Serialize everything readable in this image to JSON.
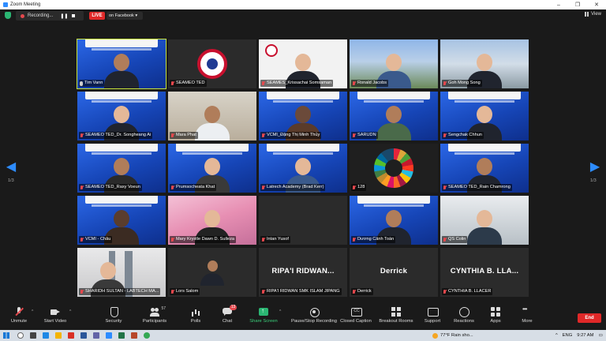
{
  "window": {
    "title": "Zoom Meeting",
    "controls": [
      "–",
      "❐",
      "✕"
    ]
  },
  "topbar": {
    "recording_label": "Recording...",
    "live_label": "LIVE",
    "live_on": "on Facebook ▾",
    "view_label": "View"
  },
  "pagination": {
    "left": "1/3",
    "right": "1/3"
  },
  "tiles": [
    {
      "name": "Tim Vann",
      "muted": false
    },
    {
      "name": "SEAMEO TED",
      "muted": true
    },
    {
      "name": "SEAMES_Krissachai Somsaman",
      "muted": true
    },
    {
      "name": "Ronald Jacobs",
      "muted": true
    },
    {
      "name": "Goh Mong Song",
      "muted": true
    },
    {
      "name": "SEAMEO TED_Dr. Songheang Ai",
      "muted": true
    },
    {
      "name": "Mara Phat",
      "muted": true
    },
    {
      "name": "VCMI_Đặng Thị Minh Thủy",
      "muted": true
    },
    {
      "name": "SARUDN",
      "muted": true
    },
    {
      "name": "Sengchak Chhun",
      "muted": true
    },
    {
      "name": "SEAMEO TED_Raxy Voeun",
      "muted": true
    },
    {
      "name": "Prumsocheata Khat",
      "muted": true
    },
    {
      "name": "Latrech Academy (Brad Kerr)",
      "muted": true
    },
    {
      "name": "128",
      "muted": true
    },
    {
      "name": "SEAMEO TED_Rain Chamrong",
      "muted": true
    },
    {
      "name": "VCMI - Châu",
      "muted": true
    },
    {
      "name": "Mary Krystle Dawn D. Sulleza",
      "muted": true
    },
    {
      "name": "Intan Yusof",
      "muted": true
    },
    {
      "name": "Dương Cảnh Toàn",
      "muted": true
    },
    {
      "name": "QS Colin",
      "muted": true
    },
    {
      "name": "SHARIDH SULTAN - LABTECH MA...",
      "muted": true
    },
    {
      "name": "Lors Salom",
      "muted": true
    },
    {
      "name": "RIPA'I RIDWAN SMK ISLAM JIPANG",
      "muted": true,
      "display": "RIPA'I RIDWAN..."
    },
    {
      "name": "Derrick",
      "muted": true,
      "display": "Derrick"
    },
    {
      "name": "CYNTHIA B. LLACER",
      "muted": true,
      "display": "CYNTHIA B. LLA..."
    }
  ],
  "toolbar": {
    "unmute": "Unmute",
    "start_video": "Start Video",
    "security": "Security",
    "participants": "Participants",
    "participants_count": "57",
    "polls": "Polls",
    "chat": "Chat",
    "chat_badge": "13",
    "share_screen": "Share Screen",
    "pause_stop_recording": "Pause/Stop Recording",
    "closed_caption": "Closed Caption",
    "breakout_rooms": "Breakout Rooms",
    "support": "Support",
    "reactions": "Reactions",
    "apps": "Apps",
    "more": "More",
    "end": "End"
  },
  "taskbar": {
    "weather": "77°F Rain sho...",
    "language": "ENG",
    "time": "9:27 AM"
  },
  "colors": {
    "accent": "#2d8cff",
    "live": "#e02828",
    "active_speaker": "#c7e33a",
    "share": "#2bb673"
  }
}
